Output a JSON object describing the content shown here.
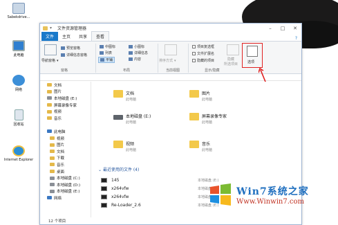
{
  "desktop": {
    "icons": [
      {
        "label": "Sabekdrive..."
      },
      {
        "label": "此电脑"
      },
      {
        "label": "网络"
      },
      {
        "label": "回收站"
      },
      {
        "label": "Internet Explorer"
      }
    ]
  },
  "window": {
    "title": "文件资源管理器",
    "tabs": [
      "文件",
      "主页",
      "共享",
      "查看"
    ],
    "ribbon": {
      "nav_pane": "导航窗格",
      "preview_pane": "预览窗格",
      "details_pane": "详细信息窗格",
      "layout": {
        "medium": "中图标",
        "small": "小图标",
        "list": "列表",
        "details": "详细信息",
        "tiles": "平铺",
        "content": "内容"
      },
      "sort": "排序方式",
      "checkbox_items": "项目复选框",
      "file_ext": "文件扩展名",
      "hidden_items": "隐藏的项目",
      "hide_selected": "隐藏",
      "hide_selected2": "所选项目",
      "options": "选项",
      "groups": {
        "pane": "窗格",
        "layout": "布局",
        "current_view": "当前视图",
        "show_hide": "显示/隐藏"
      }
    },
    "nav": [
      {
        "label": "文档",
        "type": "folder"
      },
      {
        "label": "图片",
        "type": "folder"
      },
      {
        "label": "本地磁盘 (E:)",
        "type": "drive"
      },
      {
        "label": "屏幕录像专家",
        "type": "folder"
      },
      {
        "label": "视频",
        "type": "folder"
      },
      {
        "label": "音乐",
        "type": "folder"
      },
      {
        "label": "",
        "type": "gap"
      },
      {
        "label": "此电脑",
        "type": "pc"
      },
      {
        "label": "视频",
        "type": "folder"
      },
      {
        "label": "图片",
        "type": "folder"
      },
      {
        "label": "文档",
        "type": "folder"
      },
      {
        "label": "下载",
        "type": "folder"
      },
      {
        "label": "音乐",
        "type": "folder"
      },
      {
        "label": "桌面",
        "type": "folder"
      },
      {
        "label": "本地磁盘 (C:)",
        "type": "drive"
      },
      {
        "label": "本地磁盘 (D:)",
        "type": "drive"
      },
      {
        "label": "本地磁盘 (E:)",
        "type": "drive"
      },
      {
        "label": "网络",
        "type": "pc"
      }
    ],
    "items": [
      {
        "name": "文档",
        "sub": "此电脑",
        "kind": "folder"
      },
      {
        "name": "图片",
        "sub": "此电脑",
        "kind": "folder"
      },
      {
        "name": "本地磁盘 (E:)",
        "sub": "此电脑",
        "kind": "drive"
      },
      {
        "name": "屏幕录像专家",
        "sub": "此电脑",
        "kind": "folder"
      },
      {
        "name": "视频",
        "sub": "此电脑",
        "kind": "folder"
      },
      {
        "name": "音乐",
        "sub": "此电脑",
        "kind": "folder"
      }
    ],
    "recent_header": "最近使用的文件 (4)",
    "recent": [
      {
        "name": "145",
        "path": "本地磁盘 (E:)"
      },
      {
        "name": "x264vfw",
        "path": "本地磁盘 (E:)"
      },
      {
        "name": "x264vfw",
        "path": "本地磁盘 (E:)"
      },
      {
        "name": "Re-Loader_2.6",
        "path": "本地磁盘 (E:)"
      }
    ],
    "status": "12 个项目"
  },
  "watermark": {
    "brand": "Win7系统之家",
    "url": "Www.Winwin7.com"
  }
}
